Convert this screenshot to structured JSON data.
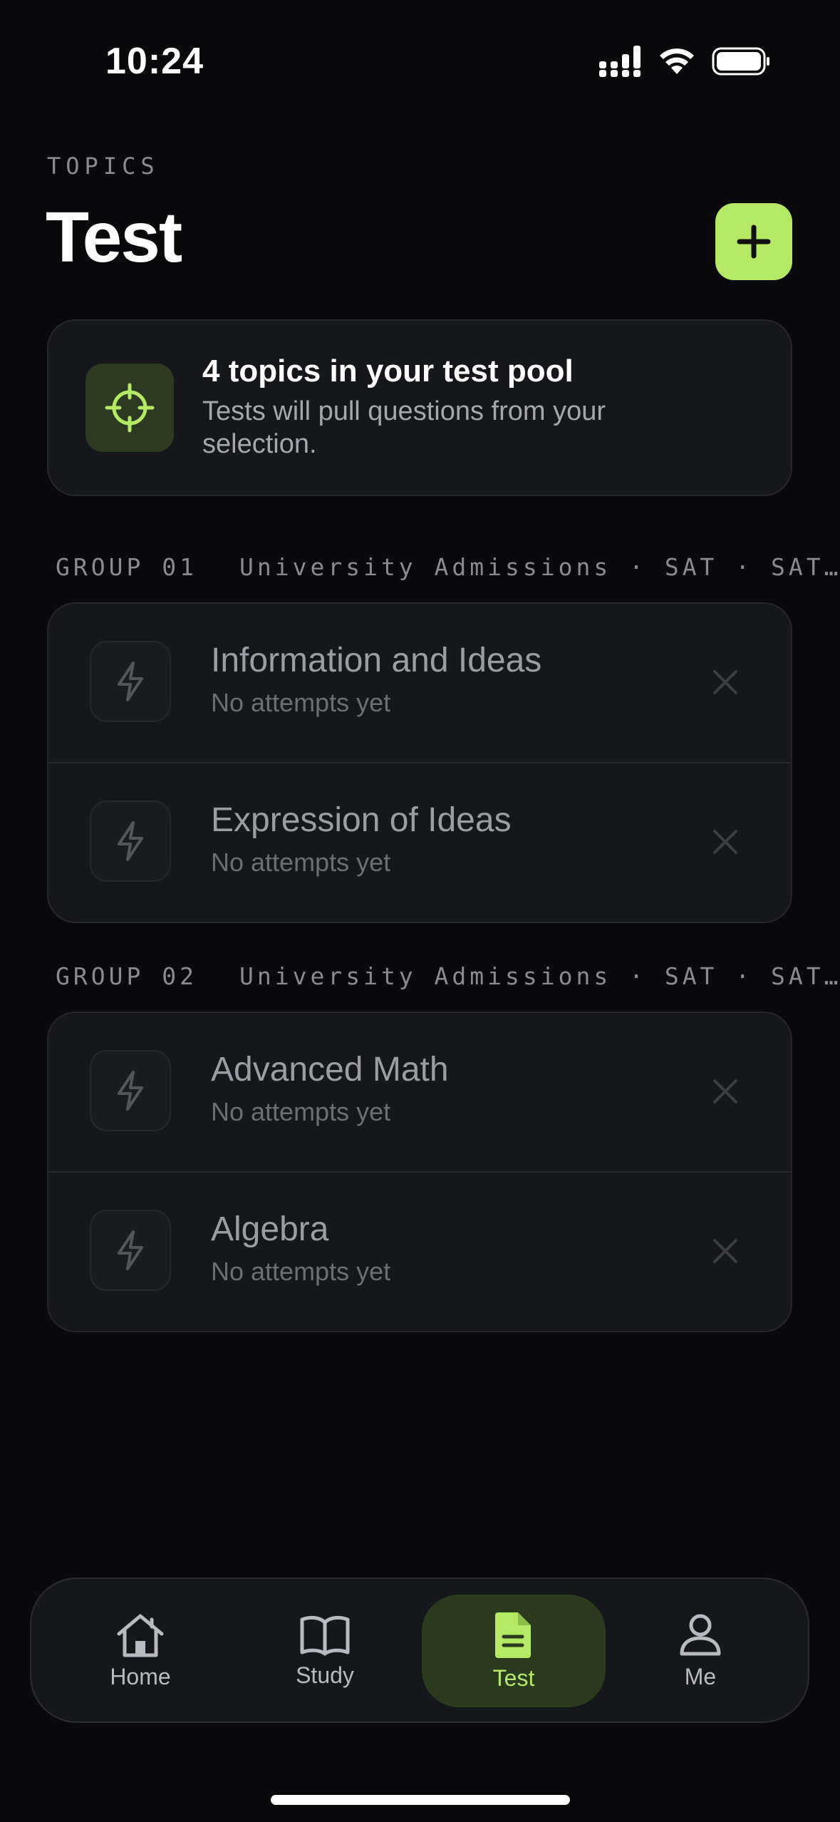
{
  "status_bar": {
    "time": "10:24"
  },
  "header": {
    "eyebrow": "TOPICS",
    "title": "Test"
  },
  "pool": {
    "title": "4 topics in your test pool",
    "subtitle": "Tests will pull questions from your selection."
  },
  "groups": [
    {
      "label": "GROUP 01",
      "path": "University Admissions · SAT · SAT…",
      "topics": [
        {
          "name": "Information and Ideas",
          "status": "No attempts yet"
        },
        {
          "name": "Expression of Ideas",
          "status": "No attempts yet"
        }
      ]
    },
    {
      "label": "GROUP 02",
      "path": "University Admissions · SAT · SAT…",
      "topics": [
        {
          "name": "Advanced Math",
          "status": "No attempts yet"
        },
        {
          "name": "Algebra",
          "status": "No attempts yet"
        }
      ]
    }
  ],
  "tabs": [
    {
      "label": "Home",
      "icon": "home-icon"
    },
    {
      "label": "Study",
      "icon": "book-icon"
    },
    {
      "label": "Test",
      "icon": "document-icon",
      "active": true
    },
    {
      "label": "Me",
      "icon": "person-icon"
    }
  ],
  "colors": {
    "accent": "#b5e865",
    "background": "#0a0a0c",
    "card": "#16171b"
  }
}
